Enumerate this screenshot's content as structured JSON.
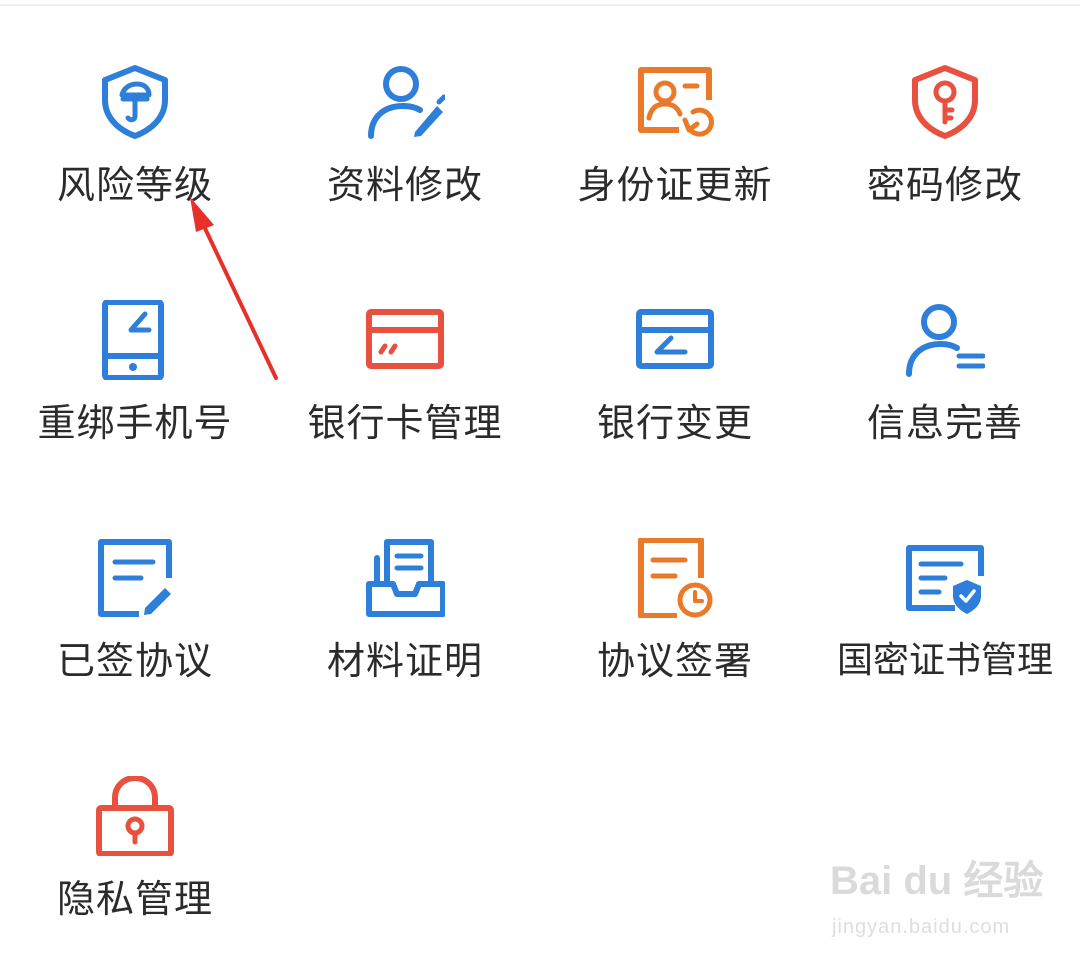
{
  "menu": {
    "items": [
      {
        "label": "风险等级",
        "icon": "risk-shield-icon",
        "color": "#2e7fd9"
      },
      {
        "label": "资料修改",
        "icon": "user-edit-icon",
        "color": "#2e7fd9"
      },
      {
        "label": "身份证更新",
        "icon": "id-card-refresh-icon",
        "color": "#ea7a2a"
      },
      {
        "label": "密码修改",
        "icon": "key-shield-icon",
        "color": "#e8503f"
      },
      {
        "label": "重绑手机号",
        "icon": "phone-icon",
        "color": "#2e7fd9"
      },
      {
        "label": "银行卡管理",
        "icon": "bank-card-icon",
        "color": "#e8503f"
      },
      {
        "label": "银行变更",
        "icon": "card-change-icon",
        "color": "#2e7fd9"
      },
      {
        "label": "信息完善",
        "icon": "user-info-icon",
        "color": "#2e7fd9"
      },
      {
        "label": "已签协议",
        "icon": "signed-doc-icon",
        "color": "#2e7fd9"
      },
      {
        "label": "材料证明",
        "icon": "document-tray-icon",
        "color": "#2e7fd9"
      },
      {
        "label": "协议签署",
        "icon": "doc-clock-icon",
        "color": "#ea7a2a"
      },
      {
        "label": "国密证书管理",
        "icon": "certificate-shield-icon",
        "color": "#2e7fd9"
      },
      {
        "label": "隐私管理",
        "icon": "padlock-icon",
        "color": "#e8503f"
      }
    ]
  },
  "annotation": {
    "arrow_color": "#e8302a"
  },
  "watermark": {
    "logo": "Bai du 经验",
    "url": "jingyan.baidu.com"
  }
}
